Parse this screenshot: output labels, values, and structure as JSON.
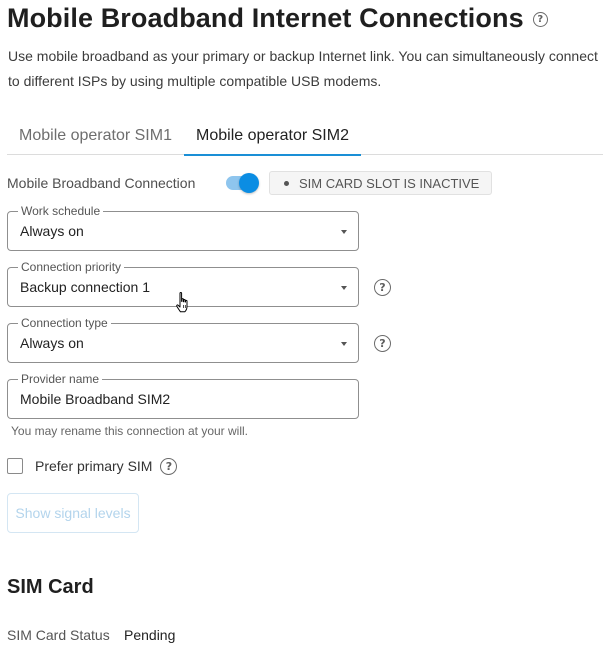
{
  "page": {
    "title": "Mobile Broadband Internet Connections",
    "help_glyph": "?",
    "description_line1": "Use mobile broadband as your primary or backup Internet link. You can simultaneously connect",
    "description_line2": "to different ISPs by using multiple compatible USB modems."
  },
  "tabs": [
    {
      "label": "Mobile operator SIM1",
      "active": false
    },
    {
      "label": "Mobile operator SIM2",
      "active": true
    }
  ],
  "connection": {
    "label": "Mobile Broadband Connection",
    "enabled": true,
    "slot_status": "SIM CARD SLOT IS INACTIVE"
  },
  "fields": {
    "work_schedule": {
      "label": "Work schedule",
      "value": "Always on"
    },
    "connection_priority": {
      "label": "Connection priority",
      "value": "Backup connection 1"
    },
    "connection_type": {
      "label": "Connection type",
      "value": "Always on"
    },
    "provider_name": {
      "label": "Provider name",
      "value": "Mobile Broadband SIM2",
      "hint": "You may rename this connection at your will."
    }
  },
  "prefer_primary": {
    "label": "Prefer primary SIM",
    "checked": false
  },
  "signal_button": {
    "label": "Show signal levels",
    "disabled": true
  },
  "sim_card": {
    "title": "SIM Card",
    "status_label": "SIM Card Status",
    "status_value": "Pending"
  },
  "colors": {
    "accent": "#0b8de3",
    "toggle_track": "#8ec5ee",
    "tab_underline": "#1a8fd6",
    "disabled_text": "#b3d4ec"
  },
  "icons": {
    "help": "question-circle-icon",
    "dropdown": "caret-down-icon",
    "cursor": "hand-pointer-cursor"
  }
}
